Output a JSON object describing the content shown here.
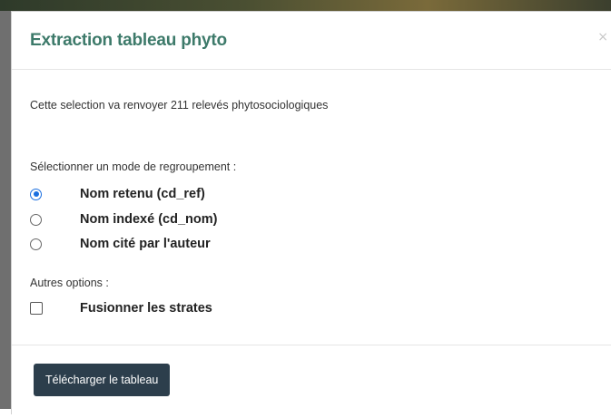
{
  "modal": {
    "title": "Extraction tableau phyto",
    "close_label": "×",
    "info": "Cette selection va renvoyer 211 relevés phytosociologiques",
    "grouping_label": "Sélectionner un mode de regroupement :",
    "grouping_options": [
      {
        "label": "Nom retenu (cd_ref)",
        "selected": true
      },
      {
        "label": "Nom indexé (cd_nom)",
        "selected": false
      },
      {
        "label": "Nom cité par l'auteur",
        "selected": false
      }
    ],
    "other_label": "Autres options :",
    "other_options": [
      {
        "label": "Fusionner les strates",
        "checked": false
      }
    ],
    "download_label": "Télécharger le tableau"
  },
  "colors": {
    "title": "#3d7a6a",
    "radio_selected": "#1a6fe0",
    "button_bg": "#2c3e4c"
  }
}
